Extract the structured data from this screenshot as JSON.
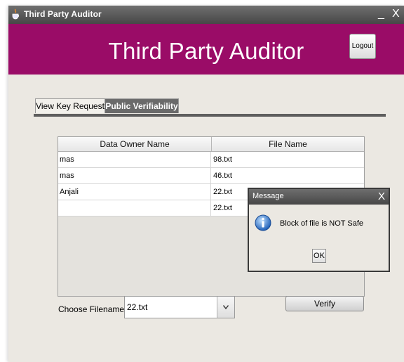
{
  "window": {
    "title": "Third Party Auditor",
    "minimize": "_",
    "close": "X"
  },
  "banner": {
    "title": "Third Party Auditor",
    "logout_label": "Logout",
    "color": "#9a0c67"
  },
  "tabs": [
    {
      "label": "View Key Request",
      "selected": false
    },
    {
      "label": "Public Verifiability",
      "selected": true
    }
  ],
  "table": {
    "columns": [
      "Data Owner Name",
      "File Name"
    ],
    "rows": [
      [
        "mas",
        "98.txt"
      ],
      [
        "mas",
        "46.txt"
      ],
      [
        "Anjali",
        "22.txt"
      ],
      [
        "",
        "22.txt"
      ]
    ]
  },
  "form": {
    "choose_label": "Choose Filename:",
    "selected_file": "22.txt",
    "verify_label": "Verify"
  },
  "dialog": {
    "title": "Message",
    "close": "X",
    "message": "Block of file is NOT Safe",
    "ok_label": "OK",
    "icon": "info-icon"
  }
}
